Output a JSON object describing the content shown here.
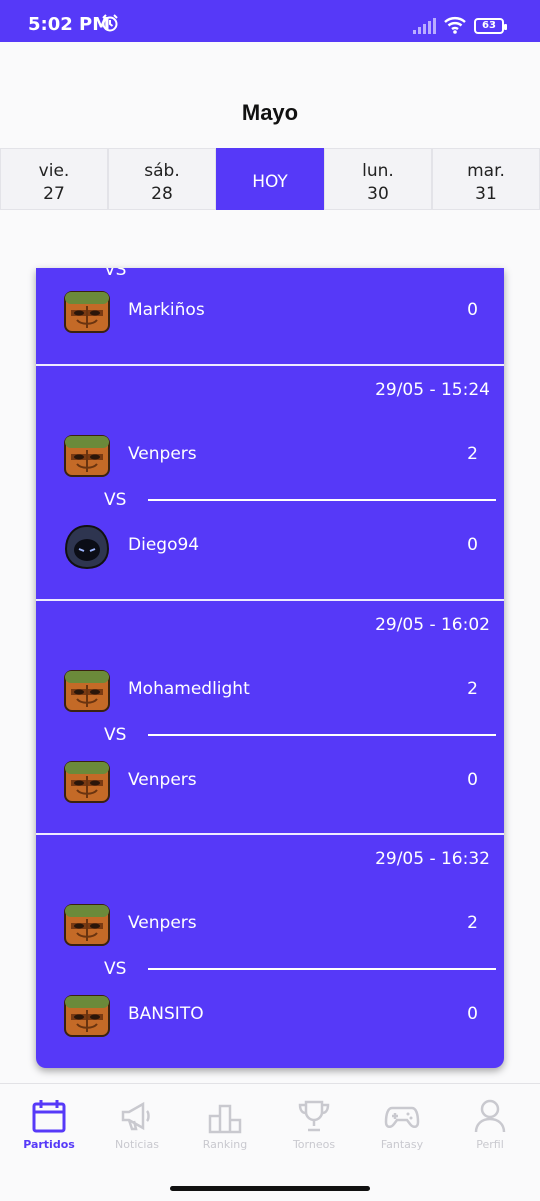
{
  "status": {
    "time": "5:02 PM",
    "battery": "63"
  },
  "header": {
    "month": "Mayo"
  },
  "days": [
    {
      "weekday": "vie.",
      "date": "27"
    },
    {
      "weekday": "sáb.",
      "date": "28"
    },
    {
      "label": "HOY"
    },
    {
      "weekday": "lun.",
      "date": "30"
    },
    {
      "weekday": "mar.",
      "date": "31"
    }
  ],
  "vs_label": "VS",
  "matches": [
    {
      "datetime": "",
      "home": {
        "name": "",
        "score": ""
      },
      "away": {
        "name": "Markiños",
        "score": "0"
      }
    },
    {
      "datetime": "29/05 - 15:24",
      "home": {
        "name": "Venpers",
        "score": "2"
      },
      "away": {
        "name": "Diego94",
        "score": "0"
      }
    },
    {
      "datetime": "29/05 - 16:02",
      "home": {
        "name": "Mohamedlight",
        "score": "2"
      },
      "away": {
        "name": "Venpers",
        "score": "0"
      }
    },
    {
      "datetime": "29/05 - 16:32",
      "home": {
        "name": "Venpers",
        "score": "2"
      },
      "away": {
        "name": "BANSITO",
        "score": "0"
      }
    }
  ],
  "nav": [
    {
      "label": "Partidos",
      "icon": "calendar-icon",
      "active": true
    },
    {
      "label": "Noticias",
      "icon": "megaphone-icon"
    },
    {
      "label": "Ranking",
      "icon": "podium-icon"
    },
    {
      "label": "Torneos",
      "icon": "trophy-icon"
    },
    {
      "label": "Fantasy",
      "icon": "gamepad-icon"
    },
    {
      "label": "Perfil",
      "icon": "user-icon"
    }
  ],
  "colors": {
    "accent": "#5639f8",
    "inactive": "#c9c9cf"
  }
}
